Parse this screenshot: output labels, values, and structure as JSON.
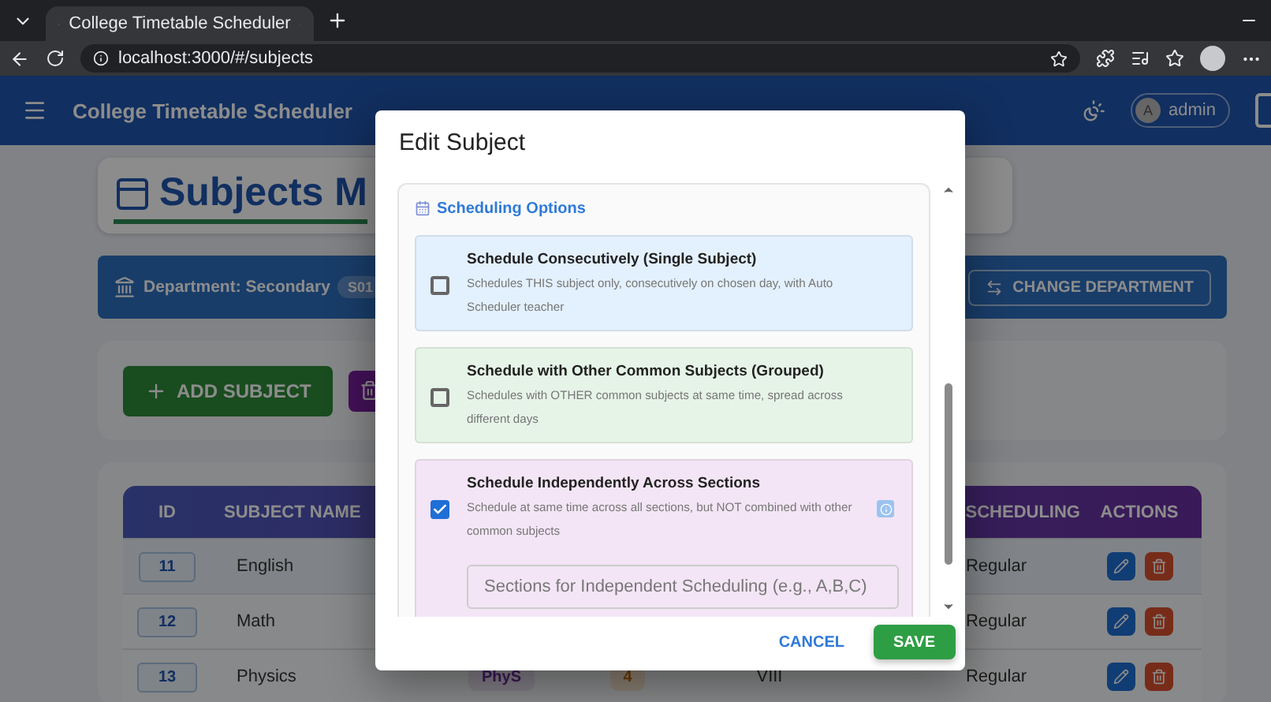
{
  "browser": {
    "tab_title": "College Timetable Scheduler",
    "url": "localhost:3000/#/subjects"
  },
  "app_bar": {
    "title": "College Timetable Scheduler",
    "user": {
      "initial": "A",
      "name": "admin"
    }
  },
  "page": {
    "heading": "Subjects M",
    "department": {
      "label": "Department: Secondary",
      "code": "S01",
      "button": "CHANGE DEPARTMENT"
    },
    "add_button": "ADD SUBJECT",
    "table": {
      "columns": [
        "ID",
        "SUBJECT NAME",
        "SCHEDULING",
        "ACTIONS"
      ],
      "rows": [
        {
          "id": "11",
          "name": "English",
          "scheduling": "Regular"
        },
        {
          "id": "12",
          "name": "Math",
          "scheduling": "Regular"
        },
        {
          "id": "13",
          "name": "Physics",
          "column_3": "PhyS",
          "column_4": "4",
          "column_5": "VIII",
          "scheduling": "Regular"
        }
      ]
    }
  },
  "dialog": {
    "title": "Edit Subject",
    "section_title": "Scheduling Options",
    "options": [
      {
        "title": "Schedule Consecutively (Single Subject)",
        "description": "Schedules THIS subject only, consecutively on chosen day, with Auto Scheduler teacher",
        "checked": false,
        "info": false,
        "color": "#e3f0fd"
      },
      {
        "title": "Schedule with Other Common Subjects (Grouped)",
        "description": "Schedules with OTHER common subjects at same time, spread across different days",
        "checked": false,
        "info": false,
        "color": "#e6f4e8"
      },
      {
        "title": "Schedule Independently Across Sections",
        "description": "Schedule at same time across all sections, but NOT combined with other common subjects",
        "checked": true,
        "info": true,
        "color": "#f3e5f5",
        "field": {
          "placeholder": "Sections for Independent Scheduling (e.g., A,B,C)"
        }
      }
    ],
    "buttons": [
      {
        "label": "CANCEL",
        "kind": "text"
      },
      {
        "label": "SAVE",
        "kind": "contained"
      }
    ]
  }
}
